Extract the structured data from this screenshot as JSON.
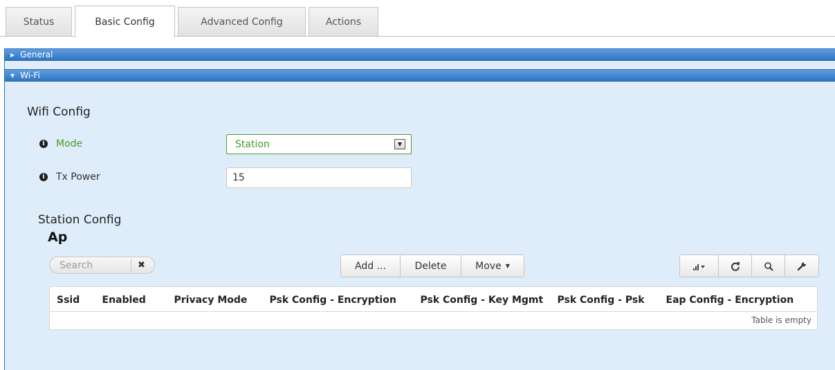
{
  "tabs": [
    {
      "label": "Status",
      "active": false
    },
    {
      "label": "Basic Config",
      "active": true
    },
    {
      "label": "Advanced Config",
      "active": false
    },
    {
      "label": "Actions",
      "active": false
    }
  ],
  "accordion": {
    "general": {
      "label": "General",
      "expanded": false
    },
    "wifi": {
      "label": "Wi-Fi",
      "expanded": true
    }
  },
  "wifi_config": {
    "title": "Wifi Config",
    "mode": {
      "label": "Mode",
      "value": "Station"
    },
    "tx_power": {
      "label": "Tx Power",
      "value": "15"
    }
  },
  "station_config": {
    "title": "Station Config",
    "table": {
      "name": "Ap",
      "search_placeholder": "Search",
      "search_clear": "✖",
      "buttons": {
        "add": "Add ...",
        "delete": "Delete",
        "move": "Move"
      },
      "tool_icons": [
        "columns-signal-icon",
        "refresh-icon",
        "search-icon",
        "wrench-icon"
      ],
      "columns": [
        "Ssid",
        "Enabled",
        "Privacy Mode",
        "Psk Config - Encryption",
        "Psk Config - Key Mgmt",
        "Psk Config - Psk",
        "Eap Config - Encryption"
      ],
      "empty_message": "Table is empty"
    }
  },
  "colors": {
    "accordion_header": "#2f74c4",
    "panel_background": "#deedf9",
    "mode_accent": "#4a9a2a"
  }
}
